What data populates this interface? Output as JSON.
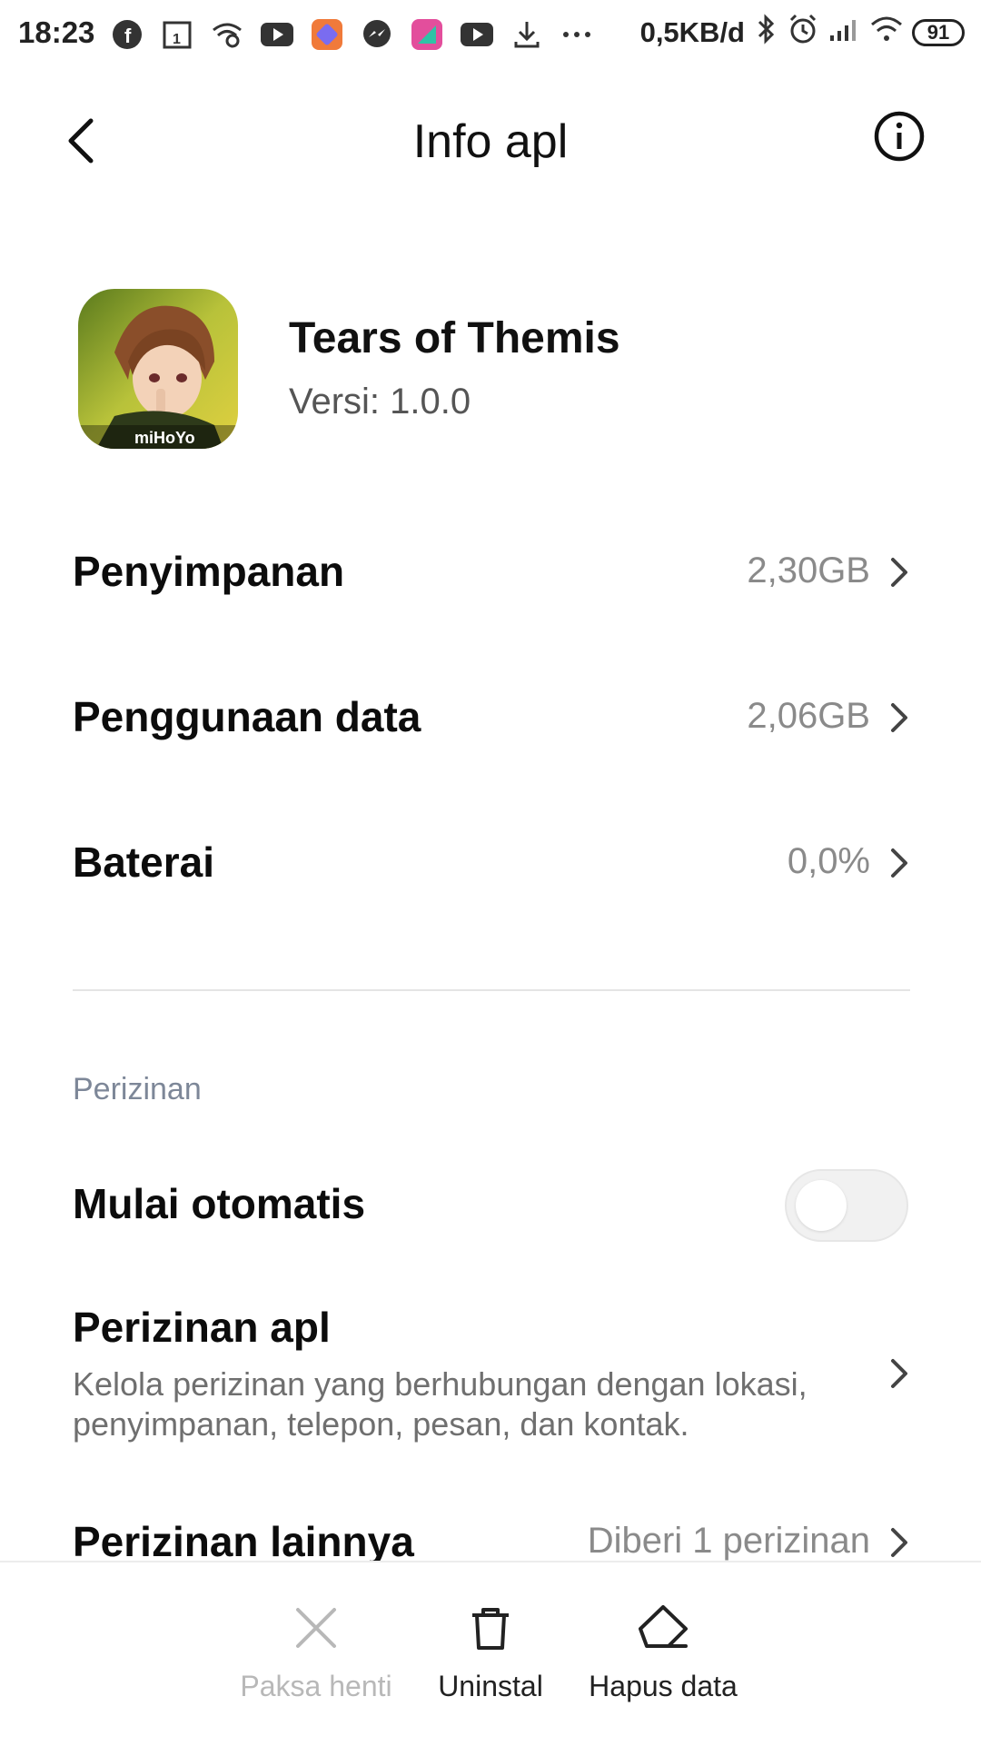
{
  "status_bar": {
    "time": "18:23",
    "net_speed": "0,5KB/d",
    "battery": "91",
    "icons": [
      "facebook-icon",
      "calendar-icon",
      "wifi-hotspot-icon",
      "youtube-icon",
      "app-icon",
      "messenger-icon",
      "app2-icon",
      "youtube-icon",
      "download-icon",
      "more-dots-icon",
      "bluetooth-icon",
      "alarm-icon",
      "signal-icon",
      "wifi-icon"
    ]
  },
  "header": {
    "title": "Info apl"
  },
  "app": {
    "name": "Tears of Themis",
    "version": "Versi: 1.0.0",
    "icon_text": "miHoYo"
  },
  "rows": {
    "storage": {
      "label": "Penyimpanan",
      "value": "2,30GB"
    },
    "data_usage": {
      "label": "Penggunaan data",
      "value": "2,06GB"
    },
    "battery": {
      "label": "Baterai",
      "value": "0,0%"
    }
  },
  "permissions": {
    "section_title": "Perizinan",
    "autostart": {
      "label": "Mulai otomatis",
      "enabled": false
    },
    "app_permissions": {
      "label": "Perizinan apl",
      "description": "Kelola perizinan yang berhubungan dengan lokasi, penyimpanan, telepon, pesan, dan kontak."
    },
    "other_permissions": {
      "label": "Perizinan lainnya",
      "value": "Diberi 1 perizinan"
    }
  },
  "actions": {
    "force_stop": "Paksa henti",
    "uninstall": "Uninstal",
    "clear_data": "Hapus data"
  }
}
